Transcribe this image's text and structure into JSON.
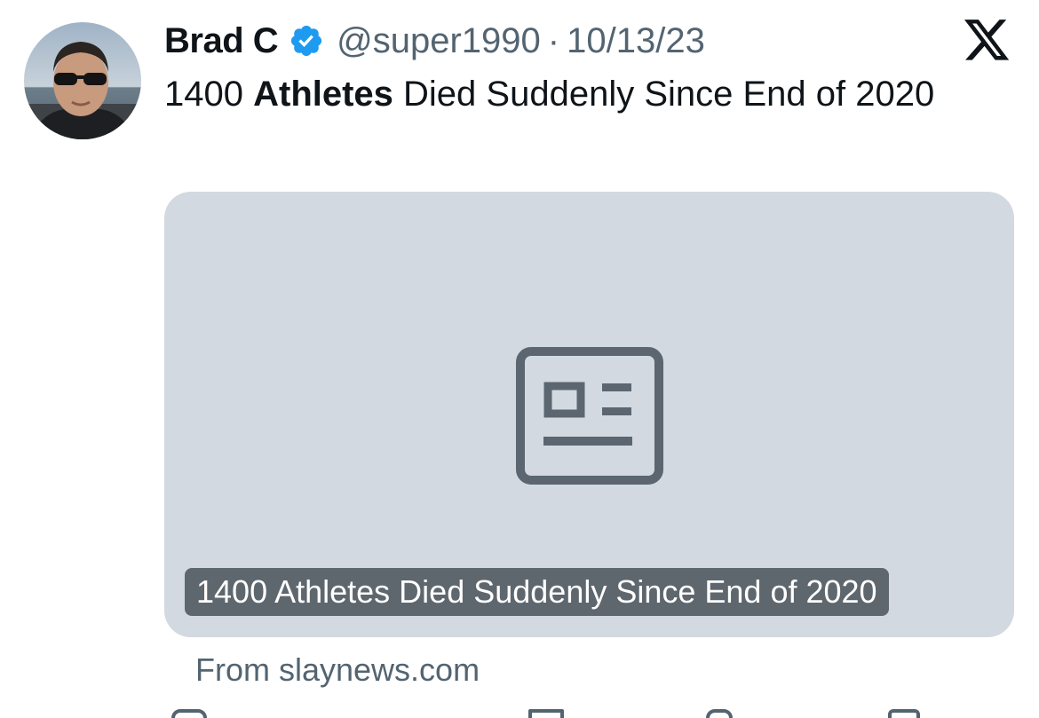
{
  "tweet": {
    "author": {
      "display_name": "Brad C",
      "verified": true,
      "handle": "@super1990"
    },
    "separator": "·",
    "date": "10/13/23",
    "text_parts": [
      "1400 ",
      "Athletes",
      " Died Suddenly Since End of 2020"
    ]
  },
  "link_card": {
    "title": "1400 Athletes Died Suddenly Since End of 2020",
    "source": "From slaynews.com",
    "icon": "article-icon"
  },
  "colors": {
    "verified_badge": "#1d9bf0",
    "secondary_text": "#536471",
    "card_background": "#d2d9e0",
    "card_label_background": "#5f676e"
  },
  "icons": [
    "avatar",
    "verified-badge-icon",
    "x-logo-icon",
    "article-icon"
  ]
}
